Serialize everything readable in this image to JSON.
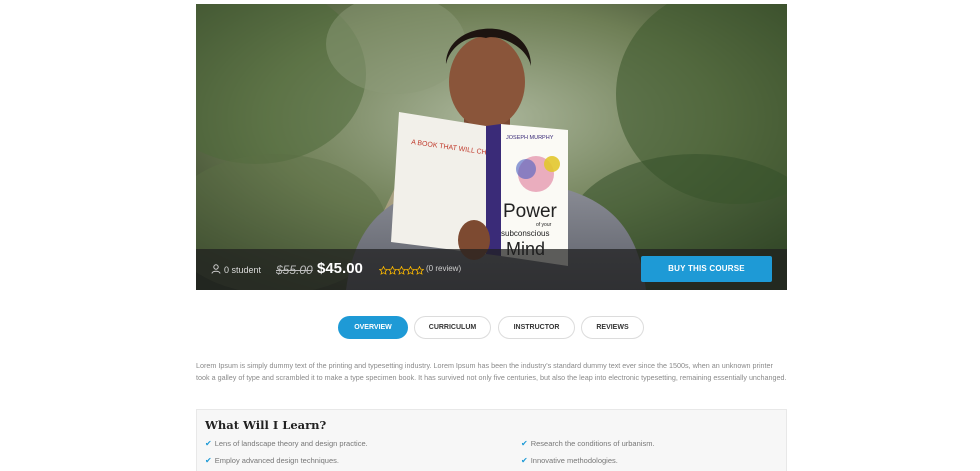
{
  "course": {
    "students_text": "0 student",
    "old_price": "$55.00",
    "new_price": "$45.00",
    "rating_stars": 0,
    "rating_max": 5,
    "reviews_text": "(0 review)",
    "buy_button": "BUY THIS COURSE"
  },
  "book_cover": {
    "tagline": "A BOOK THAT WILL CHANGE YOUR LIFE",
    "author": "JOSEPH MURPHY",
    "title_line1": "Power",
    "title_line2": "of your",
    "title_line3": "subconscious",
    "title_line4": "Mind"
  },
  "tabs": [
    {
      "label": "OVERVIEW",
      "active": true
    },
    {
      "label": "CURRICULUM",
      "active": false
    },
    {
      "label": "INSTRUCTOR",
      "active": false
    },
    {
      "label": "REVIEWS",
      "active": false
    }
  ],
  "overview": {
    "text": "Lorem Ipsum is simply dummy text of the printing and typesetting industry. Lorem Ipsum has been the industry's standard dummy text ever since the 1500s, when an unknown printer took a galley of type and scrambled it to make a type specimen book. It has survived not only five centuries, but also the leap into electronic typesetting, remaining essentially unchanged."
  },
  "learn": {
    "title": "What Will I Learn?",
    "items": [
      "Lens of landscape theory and design practice.",
      "Research the conditions of urbanism.",
      "Employ advanced design techniques.",
      "Innovative methodologies."
    ]
  },
  "colors": {
    "accent": "#1e9ad6",
    "star": "#f5b400"
  },
  "icons": {
    "students": "user-icon",
    "star": "star-outline-icon",
    "check": "check-icon"
  }
}
